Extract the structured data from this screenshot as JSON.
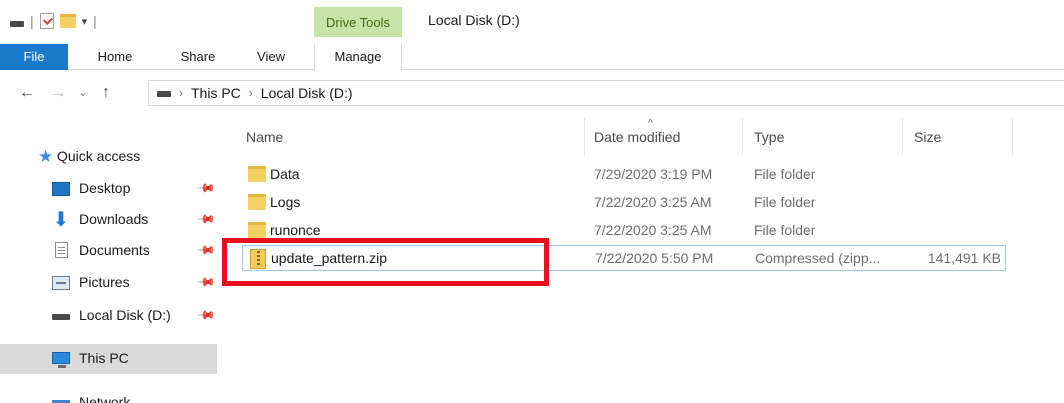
{
  "titlebar": {
    "context_tab_label": "Drive Tools",
    "window_title": "Local Disk (D:)",
    "qat_separator": "|",
    "qat_dropdown": "▾"
  },
  "ribbon": {
    "tabs": [
      {
        "label": "File"
      },
      {
        "label": "Home"
      },
      {
        "label": "Share"
      },
      {
        "label": "View"
      },
      {
        "label": "Manage"
      }
    ]
  },
  "addressbar": {
    "back": "←",
    "forward": "→",
    "recent": "⌄",
    "up": "↑",
    "crumb_separator": "›",
    "breadcrumbs": [
      "This PC",
      "Local Disk (D:)"
    ]
  },
  "navpane": {
    "quick_access": "Quick access",
    "items": [
      {
        "label": "Desktop",
        "icon": "desktop-icon",
        "pinned": true
      },
      {
        "label": "Downloads",
        "icon": "download-icon",
        "pinned": true
      },
      {
        "label": "Documents",
        "icon": "documents-icon",
        "pinned": true
      },
      {
        "label": "Pictures",
        "icon": "pictures-icon",
        "pinned": true
      },
      {
        "label": "Local Disk (D:)",
        "icon": "disk-icon",
        "pinned": true
      }
    ],
    "this_pc": "This PC",
    "network": "Network",
    "pin_glyph": "📌"
  },
  "filelist": {
    "sort_indicator": "^",
    "columns": {
      "name": "Name",
      "date": "Date modified",
      "type": "Type",
      "size": "Size"
    },
    "rows": [
      {
        "name": "Data",
        "date": "7/29/2020 3:19 PM",
        "type": "File folder",
        "size": "",
        "icon": "folder-icon"
      },
      {
        "name": "Logs",
        "date": "7/22/2020 3:25 AM",
        "type": "File folder",
        "size": "",
        "icon": "folder-icon"
      },
      {
        "name": "runonce",
        "date": "7/22/2020 3:25 AM",
        "type": "File folder",
        "size": "",
        "icon": "folder-icon"
      },
      {
        "name": "update_pattern.zip",
        "date": "7/22/2020 5:50 PM",
        "type": "Compressed (zipp...",
        "size": "141,491 KB",
        "icon": "zip-icon"
      }
    ]
  },
  "colors": {
    "file_tab": "#1979ca",
    "context_tab": "#c7e4a8",
    "highlight": "#e8101a",
    "selection_border": "#99c9ef"
  }
}
